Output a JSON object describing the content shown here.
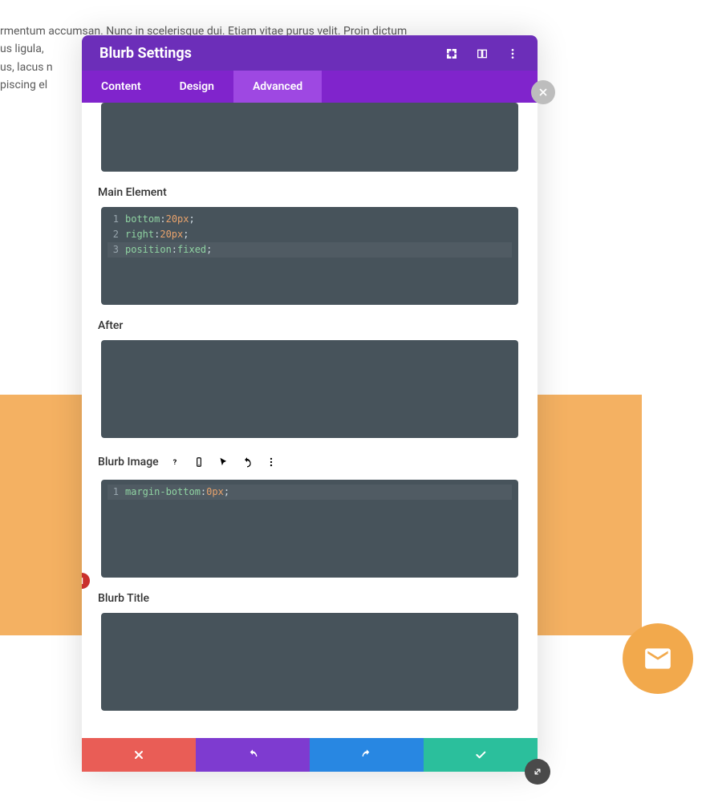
{
  "background": {
    "lines": [
      "rmentum accumsan. Nunc in scelerisque dui. Etiam vitae purus velit. Proin dictum",
      "us ligula, ",
      "us, lacus n",
      "piscing el"
    ]
  },
  "modal": {
    "title": "Blurb Settings"
  },
  "tabs": {
    "content": "Content",
    "design": "Design",
    "advanced": "Advanced"
  },
  "sections": {
    "main_element": {
      "label": "Main Element",
      "lines": [
        {
          "n": "1",
          "prop": "bottom",
          "val": "20px"
        },
        {
          "n": "2",
          "prop": "right",
          "val": "20px"
        },
        {
          "n": "3",
          "prop": "position",
          "val": "fixed"
        }
      ]
    },
    "after": {
      "label": "After"
    },
    "blurb_image": {
      "label": "Blurb Image",
      "lines": [
        {
          "n": "1",
          "prop": "margin-bottom",
          "val": "0px"
        }
      ]
    },
    "blurb_title": {
      "label": "Blurb Title"
    }
  },
  "badge": "1"
}
